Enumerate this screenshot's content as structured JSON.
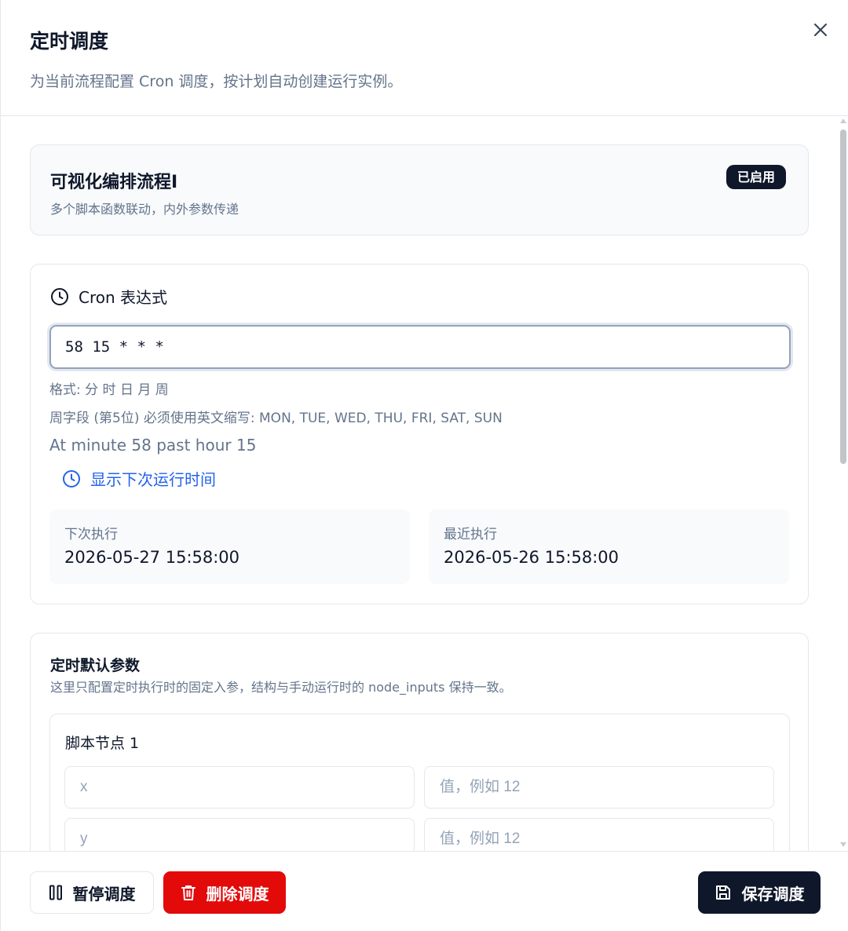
{
  "dialog": {
    "title": "定时调度",
    "subtitle": "为当前流程配置 Cron 调度，按计划自动创建运行实例。",
    "close_icon": "close-icon"
  },
  "flow": {
    "name": "可视化编排流程I",
    "description": "多个脚本函数联动，内外参数传递",
    "status_badge": "已启用"
  },
  "cron": {
    "heading": "Cron 表达式",
    "expression": "58 15 * * *",
    "format_hint": "格式: 分 时 日 月 周",
    "week_hint": "周字段 (第5位) 必须使用英文缩写: MON, TUE, WED, THU, FRI, SAT, SUN",
    "human_readable": "At minute 58 past hour 15",
    "show_next_label": "显示下次运行时间",
    "next_run_label": "下次执行",
    "next_run_value": "2026-05-27 15:58:00",
    "last_run_label": "最近执行",
    "last_run_value": "2026-05-26 15:58:00"
  },
  "params": {
    "title": "定时默认参数",
    "description": "这里只配置定时执行时的固定入参，结构与手动运行时的 node_inputs 保持一致。",
    "nodes": [
      {
        "title": "脚本节点 1",
        "fields": [
          {
            "name_placeholder": "x",
            "value_placeholder": "值，例如 12"
          },
          {
            "name_placeholder": "y",
            "value_placeholder": "值，例如 12"
          }
        ]
      }
    ]
  },
  "footer": {
    "pause_label": "暂停调度",
    "delete_label": "删除调度",
    "save_label": "保存调度"
  },
  "colors": {
    "primary_dark": "#0f172a",
    "danger": "#e30a0a",
    "link": "#2563eb",
    "muted_text": "#64748b"
  }
}
